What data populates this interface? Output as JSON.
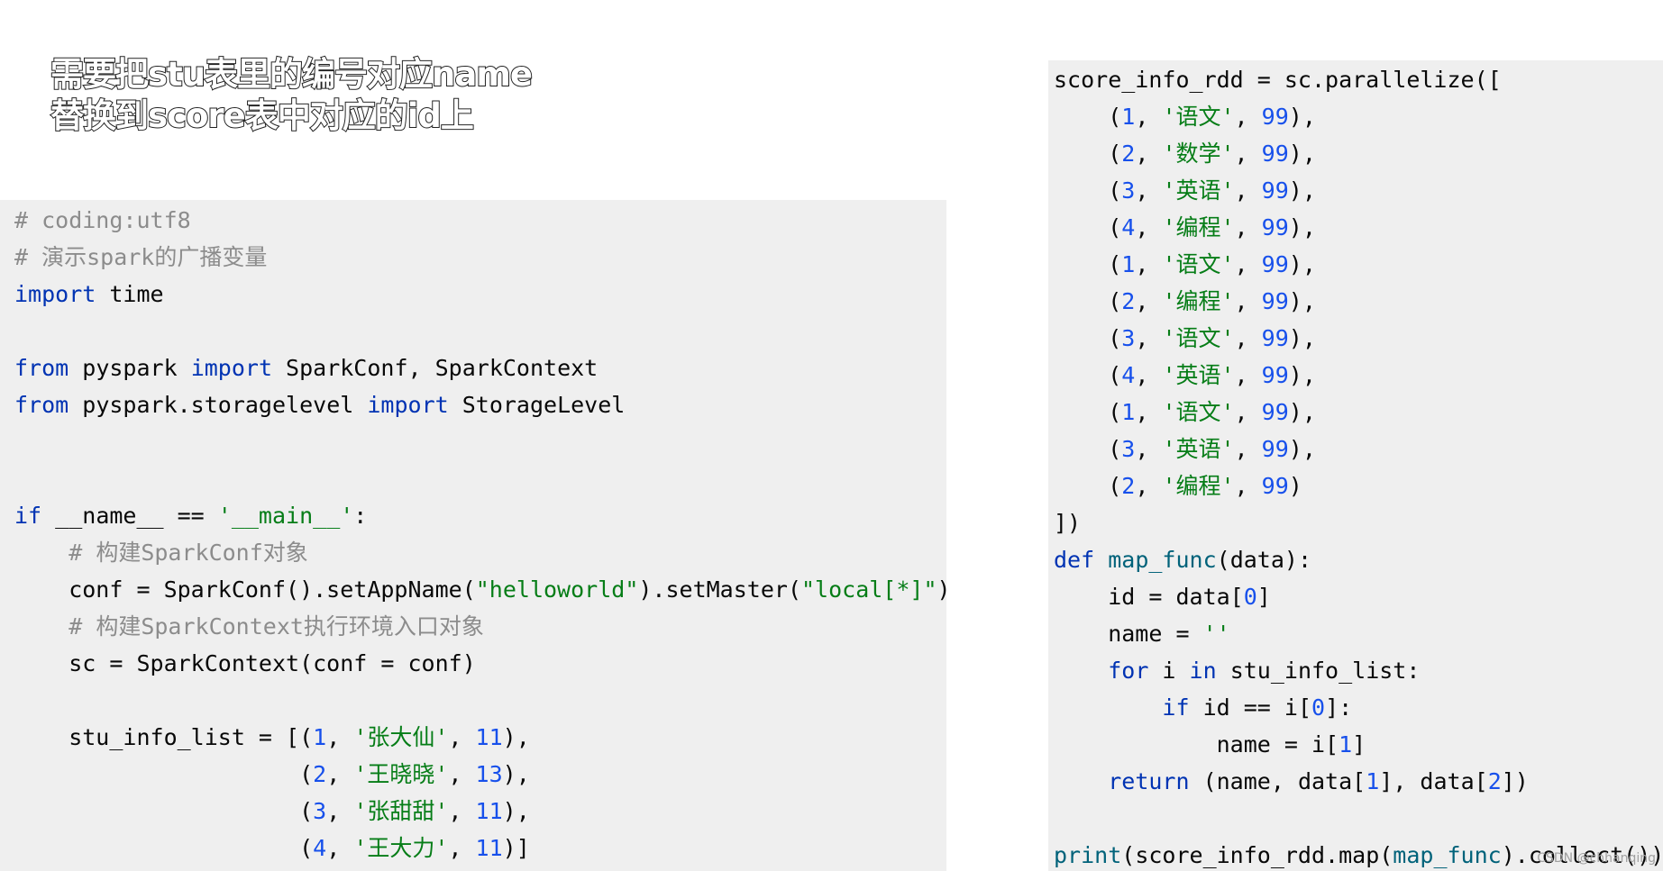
{
  "headline": {
    "line1": "需要把stu表里的编号对应name",
    "line2": "替换到score表中对应的id上"
  },
  "left_code": [
    "# coding:utf8",
    "# 演示spark的广播变量",
    "import time",
    "",
    "from pyspark import SparkConf, SparkContext",
    "from pyspark.storagelevel import StorageLevel",
    "",
    "",
    "if __name__ == '__main__':",
    "    # 构建SparkConf对象",
    "    conf = SparkConf().setAppName(\"helloworld\").setMaster(\"local[*]\")",
    "    # 构建SparkContext执行环境入口对象",
    "    sc = SparkContext(conf = conf)",
    "",
    "    stu_info_list = [(1, '张大仙', 11),",
    "                     (2, '王晓晓', 13),",
    "                     (3, '张甜甜', 11),",
    "                     (4, '王大力', 11)]"
  ],
  "right_code": [
    "score_info_rdd = sc.parallelize([",
    "    (1, '语文', 99),",
    "    (2, '数学', 99),",
    "    (3, '英语', 99),",
    "    (4, '编程', 99),",
    "    (1, '语文', 99),",
    "    (2, '编程', 99),",
    "    (3, '语文', 99),",
    "    (4, '英语', 99),",
    "    (1, '语文', 99),",
    "    (3, '英语', 99),",
    "    (2, '编程', 99)",
    "])",
    "def map_func(data):",
    "    id = data[0]",
    "    name = ''",
    "    for i in stu_info_list:",
    "        if id == i[0]:",
    "            name = i[1]",
    "    return (name, data[1], data[2])",
    "",
    "print(score_info_rdd.map(map_func).collect())"
  ],
  "watermark": "CSDN @chhanqing",
  "colors": {
    "panel_bg": "#efefef",
    "keyword": "#0033b3",
    "comment": "#8c8c8c",
    "string": "#067d17",
    "number": "#1750eb"
  }
}
